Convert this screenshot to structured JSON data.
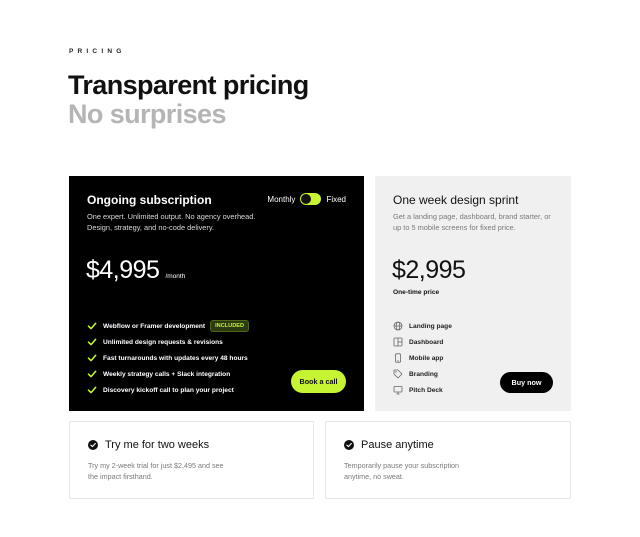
{
  "header": {
    "eyebrow": "PRICING",
    "title": "Transparent pricing",
    "subtitle": "No surprises"
  },
  "subscription": {
    "title": "Ongoing subscription",
    "toggle_left": "Monthly",
    "toggle_right": "Fixed",
    "description": "One expert. Unlimited output. No agency overhead. Design, strategy, and no-code delivery.",
    "price": "$4,995",
    "period": "/month",
    "features": [
      {
        "label": "Webflow or Framer development",
        "badge": "INCLUDED"
      },
      {
        "label": "Unlimited design requests & revisions"
      },
      {
        "label": "Fast turnarounds with updates every 48 hours"
      },
      {
        "label": "Weekly strategy calls + Slack integration"
      },
      {
        "label": "Discovery kickoff call to plan your project"
      }
    ],
    "cta": "Book a call",
    "accent": "#c6f432"
  },
  "sprint": {
    "title": "One week design sprint",
    "description": "Get a landing page, dashboard, brand starter, or up to 5 mobile screens for fixed price.",
    "price": "$2,995",
    "price_note": "One-time price",
    "items": [
      {
        "label": "Landing page",
        "icon": "globe-icon"
      },
      {
        "label": "Dashboard",
        "icon": "dashboard-icon"
      },
      {
        "label": "Mobile app",
        "icon": "phone-icon"
      },
      {
        "label": "Branding",
        "icon": "tag-icon"
      },
      {
        "label": "Pitch Deck",
        "icon": "monitor-icon"
      }
    ],
    "cta": "Buy now"
  },
  "extras": [
    {
      "title": "Try me for two weeks",
      "description": "Try my 2-week trial for just $2,495 and see the impact firsthand."
    },
    {
      "title": "Pause anytime",
      "description": "Temporarily pause your subscription anytime, no sweat."
    }
  ]
}
